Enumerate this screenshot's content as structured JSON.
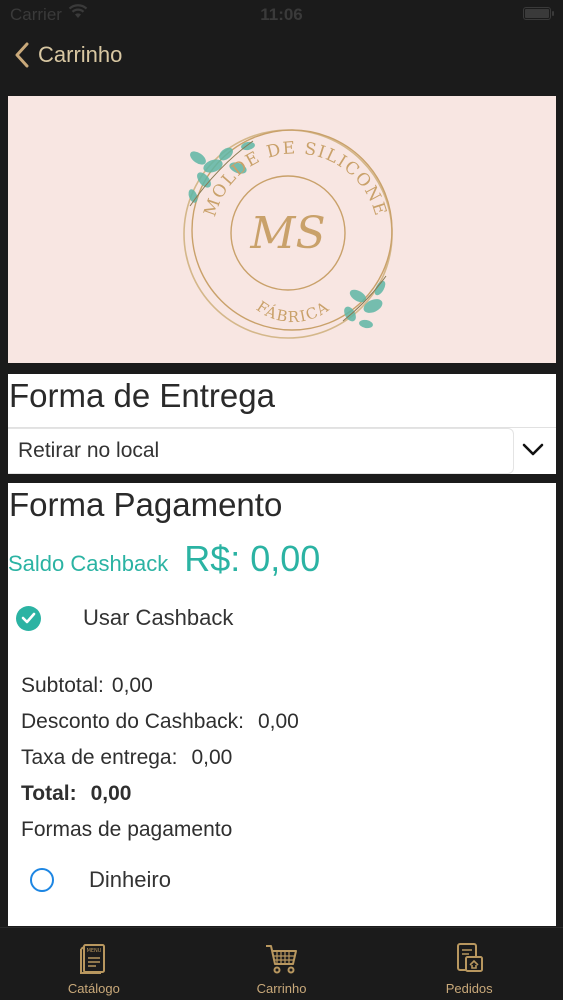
{
  "status_bar": {
    "carrier": "Carrier",
    "time": "11:06"
  },
  "nav": {
    "back_label": "Carrinho"
  },
  "banner": {
    "brand_top": "MOLDE DE SILICONE",
    "monogram": "MS",
    "brand_bottom": "FÁBRICA",
    "colors": {
      "background": "#f8e6e2",
      "gold": "#c9a16a",
      "leaf": "#5fb7a6"
    }
  },
  "delivery": {
    "title": "Forma de Entrega",
    "selected_option": "Retirar no local"
  },
  "payment": {
    "title": "Forma Pagamento",
    "cashback_label": "Saldo Cashback",
    "cashback_value": "R$: 0,00",
    "use_cashback_label": "Usar Cashback",
    "use_cashback_checked": true,
    "summary": {
      "subtotal_label": "Subtotal:",
      "subtotal_value": "0,00",
      "discount_label": "Desconto do Cashback:",
      "discount_value": "0,00",
      "fee_label": "Taxa de entrega:",
      "fee_value": "0,00",
      "total_label": "Total:",
      "total_value": "0,00",
      "methods_label": "Formas de pagamento"
    },
    "method_option": "Dinheiro",
    "method_selected": false
  },
  "tabs": [
    {
      "label": "Catálogo",
      "icon": "menu-card-icon"
    },
    {
      "label": "Carrinho",
      "icon": "cart-icon"
    },
    {
      "label": "Pedidos",
      "icon": "orders-icon"
    }
  ],
  "colors": {
    "accent_teal": "#2bb3a3",
    "tab_gold": "#c9a97a",
    "radio_blue": "#1d86e3"
  }
}
